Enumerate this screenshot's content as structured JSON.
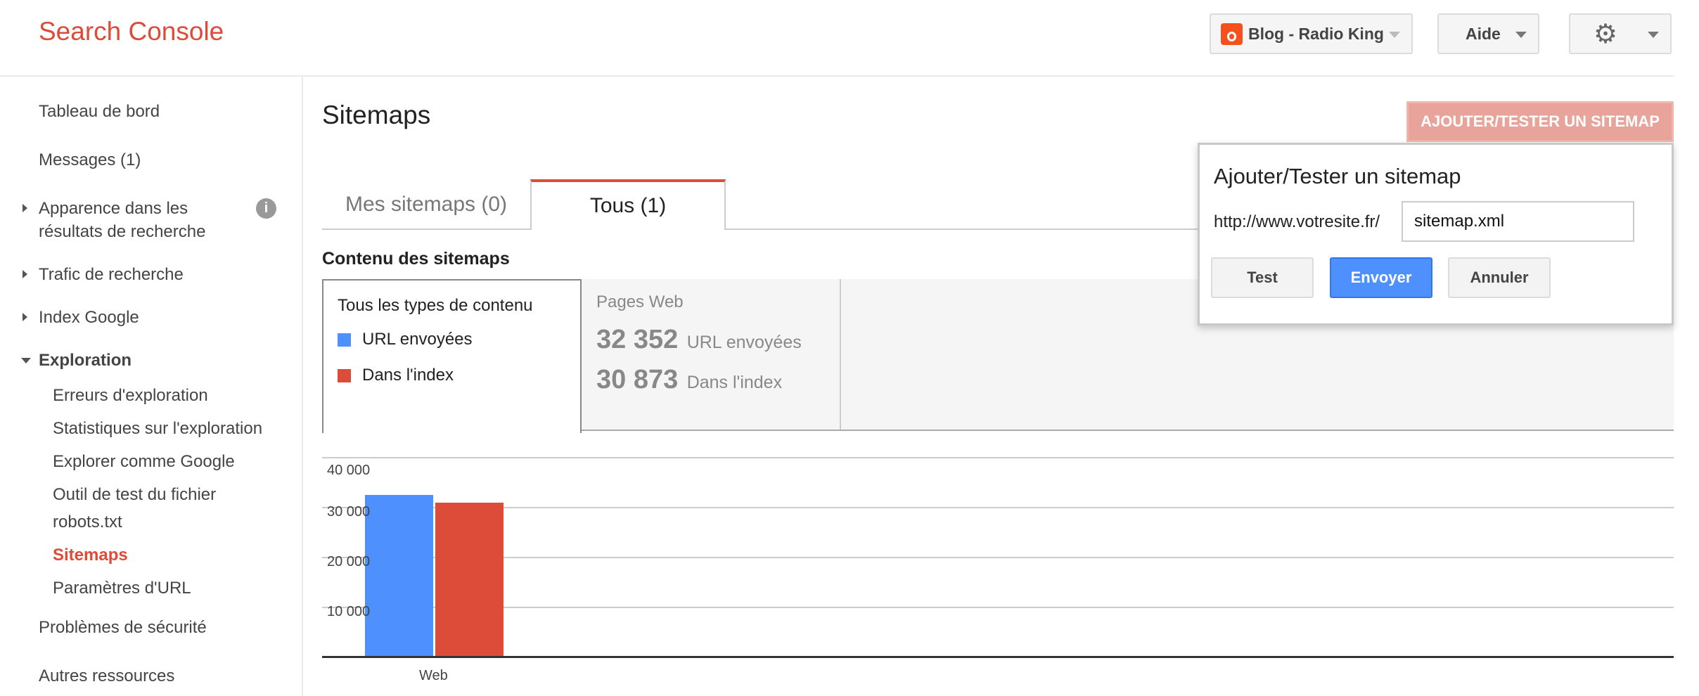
{
  "header": {
    "brand": "Search Console",
    "site_selector": "Blog - Radio King",
    "help": "Aide",
    "settings_icon": "gear-icon"
  },
  "sidebar": {
    "items": [
      {
        "label": "Tableau de bord"
      },
      {
        "label": "Messages (1)"
      },
      {
        "label": "Apparence dans les résultats de recherche",
        "line1": "Apparence dans les",
        "line2": "résultats de recherche"
      },
      {
        "label": "Trafic de recherche"
      },
      {
        "label": "Index Google"
      },
      {
        "label": "Exploration"
      },
      {
        "label": "Problèmes de sécurité"
      },
      {
        "label": "Autres ressources"
      }
    ],
    "sub_items": [
      {
        "label": "Erreurs d'exploration"
      },
      {
        "label": "Statistiques sur l'exploration"
      },
      {
        "label": "Explorer comme Google"
      },
      {
        "label": "Outil de test du fichier robots.txt",
        "line1": "Outil de test du fichier",
        "line2": "robots.txt"
      },
      {
        "label": "Sitemaps",
        "active": true
      },
      {
        "label": "Paramètres d'URL"
      }
    ]
  },
  "main": {
    "title": "Sitemaps",
    "add_button": "AJOUTER/TESTER UN SITEMAP",
    "tabs": [
      {
        "label": "Mes sitemaps (0)"
      },
      {
        "label": "Tous (1)",
        "active": true
      }
    ],
    "section_title": "Contenu des sitemaps",
    "legend": {
      "title": "Tous les types de contenu",
      "items": [
        {
          "label": "URL envoyées",
          "color": "#4d90fe"
        },
        {
          "label": "Dans l'index",
          "color": "#dd4b39"
        }
      ]
    },
    "pages_web": {
      "title": "Pages Web",
      "submitted_value": "32 352",
      "submitted_label": "URL envoyées",
      "indexed_value": "30 873",
      "indexed_label": "Dans l'index"
    }
  },
  "dialog": {
    "title": "Ajouter/Tester un sitemap",
    "prefix": "http://www.votresite.fr/",
    "input_value": "sitemap.xml",
    "test": "Test",
    "submit": "Envoyer",
    "cancel": "Annuler"
  },
  "chart_data": {
    "type": "bar",
    "categories": [
      "Web"
    ],
    "series": [
      {
        "name": "URL envoyées",
        "values": [
          32352
        ],
        "color": "#4d90fe"
      },
      {
        "name": "Dans l'index",
        "values": [
          30873
        ],
        "color": "#dd4b39"
      }
    ],
    "ylim": [
      0,
      40000
    ],
    "yticks": [
      "10 000",
      "20 000",
      "30 000",
      "40 000"
    ],
    "grid": true
  }
}
